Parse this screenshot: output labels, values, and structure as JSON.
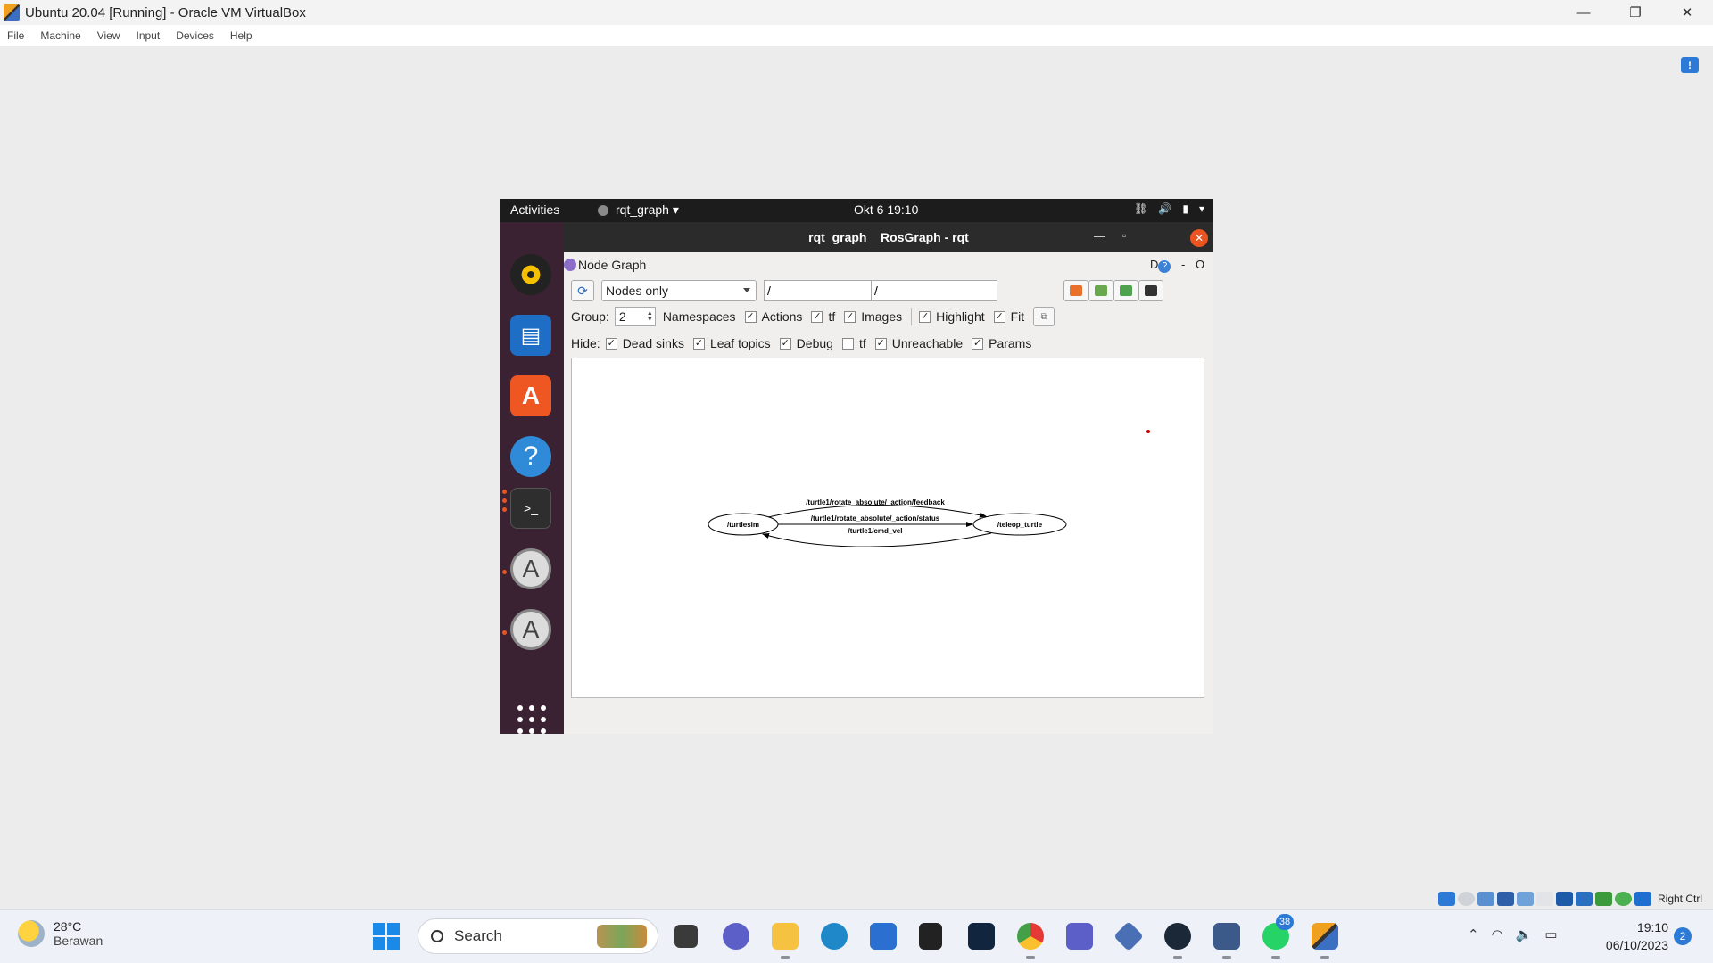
{
  "host": {
    "title": "Ubuntu 20.04 [Running] - Oracle VM VirtualBox",
    "controls": [
      "—",
      "❐",
      "✕"
    ],
    "menu": [
      "File",
      "Machine",
      "View",
      "Input",
      "Devices",
      "Help"
    ],
    "notify_glyph": "!"
  },
  "gnome": {
    "activities": "Activities",
    "app_menu": "rqt_graph ▾",
    "clock": "Okt 6  19:10",
    "tray_icons": [
      "network-icon",
      "volume-icon",
      "battery-icon",
      "menu-arrow-icon"
    ],
    "dock_apps": [
      "rhythmbox",
      "libreoffice-writer",
      "ubuntu-software",
      "help",
      "terminal",
      "software-updater",
      "software-updater"
    ]
  },
  "rqt": {
    "window_title": "rqt_graph__RosGraph - rqt",
    "min_glyph": "—",
    "max_glyph": "▫",
    "close_glyph": "✕",
    "plugin_title": "Node Graph",
    "dock_help": "D",
    "dock_minus": "-",
    "dock_close": "O",
    "refresh_glyph": "⟳",
    "mode_value": "Nodes only",
    "filter_ns_value": "/",
    "filter_topic_value": "/",
    "toolbar_buttons": [
      "load-dot-icon",
      "save-dot-icon",
      "save-image-icon",
      "fullscreen-icon"
    ],
    "group_label": "Group:",
    "group_value": "2",
    "options": [
      {
        "label": "Namespaces",
        "checked": false
      },
      {
        "label": "Actions",
        "checked": true
      },
      {
        "label": "tf",
        "checked": true
      },
      {
        "label": "Images",
        "checked": true
      },
      {
        "label": "Highlight",
        "checked": true
      },
      {
        "label": "Fit",
        "checked": true
      }
    ],
    "hide_label": "Hide:",
    "hide_options": [
      {
        "label": "Dead sinks",
        "checked": true
      },
      {
        "label": "Leaf topics",
        "checked": true
      },
      {
        "label": "Debug",
        "checked": true
      },
      {
        "label": "tf",
        "checked": false
      },
      {
        "label": "Unreachable",
        "checked": true
      },
      {
        "label": "Params",
        "checked": true
      }
    ],
    "graph": {
      "nodes": [
        "/turtlesim",
        "/teleop_turtle"
      ],
      "edges": [
        {
          "label": "/turtle1/rotate_absolute/_action/feedback",
          "from": "/turtlesim",
          "to": "/teleop_turtle"
        },
        {
          "label": "/turtle1/rotate_absolute/_action/status",
          "from": "/turtlesim",
          "to": "/teleop_turtle"
        },
        {
          "label": "/turtle1/cmd_vel",
          "from": "/teleop_turtle",
          "to": "/turtlesim"
        }
      ]
    }
  },
  "vbox_status": {
    "right_ctrl": "Right Ctrl"
  },
  "taskbar": {
    "temperature": "28°C",
    "condition": "Berawan",
    "search_placeholder": "Search",
    "pinned": [
      "task-view",
      "teams-chat",
      "file-explorer",
      "edge",
      "microsoft-store",
      "dropbox",
      "vscode-ish",
      "chrome",
      "teams",
      "vmware",
      "steam",
      "virtualbox-box",
      "whatsapp",
      "virtualbox"
    ],
    "whatsapp_badge": "38",
    "time": "19:10",
    "date": "06/10/2023",
    "notification_count": "2"
  }
}
